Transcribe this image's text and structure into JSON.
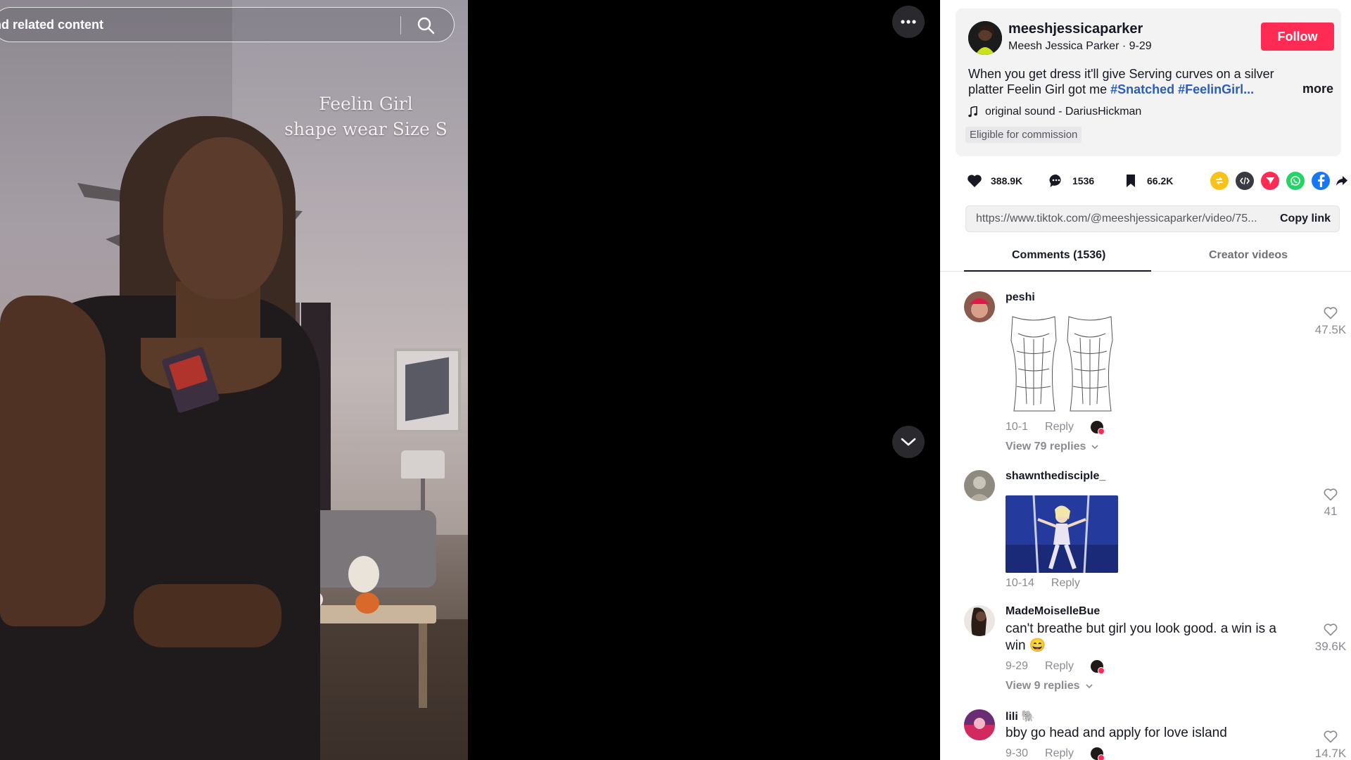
{
  "search": {
    "text": "nd related content",
    "icon": "search-icon"
  },
  "video": {
    "caption_line1": "Feelin Girl",
    "caption_line2": "shape wear Size S"
  },
  "stage": {
    "more_icon": "ellipsis-icon",
    "next_icon": "chevron-down-icon"
  },
  "post": {
    "username": "meeshjessicaparker",
    "display_name": "Meesh Jessica Parker",
    "date": "9-29",
    "follow_label": "Follow",
    "description_text": "When you get dress it'll give Serving curves on a silver platter Feelin Girl got me ",
    "hashtag1": "#Snatched",
    "hashtag2": "#FeelinGirl",
    "ellipsis": "...",
    "more_label": "more",
    "sound": "original sound - DariusHickman",
    "commission": "Eligible for commission"
  },
  "actions": {
    "likes": "388.9K",
    "comments": "1536",
    "saves": "66.2K",
    "share_icons": [
      "repost-icon",
      "embed-icon",
      "send-icon",
      "whatsapp-icon",
      "facebook-icon",
      "share-arrow-icon"
    ]
  },
  "link": {
    "url": "https://www.tiktok.com/@meeshjessicaparker/video/75...",
    "copy_label": "Copy link"
  },
  "tabs": {
    "comments": "Comments (1536)",
    "creator": "Creator videos"
  },
  "comments": [
    {
      "user": "peshi",
      "text": "",
      "date": "10-1",
      "reply": "Reply",
      "view_replies": "View 79 replies",
      "likes": "47.5K"
    },
    {
      "user": "shawnthedisciple_",
      "text": "",
      "date": "10-14",
      "reply": "Reply",
      "likes": "41"
    },
    {
      "user": "MadeMoiselleBue",
      "text": "can't breathe but girl you look good. a win is a win 😄",
      "date": "9-29",
      "reply": "Reply",
      "view_replies": "View 9 replies",
      "likes": "39.6K"
    },
    {
      "user": "lili 🐘",
      "text": "bby go head and apply for love island",
      "date": "9-30",
      "reply": "Reply",
      "likes": "14.7K"
    }
  ],
  "colors": {
    "accent": "#fe2c55",
    "hashtag": "#2b5db9",
    "text": "#161823",
    "muted": "#8a8b91"
  }
}
